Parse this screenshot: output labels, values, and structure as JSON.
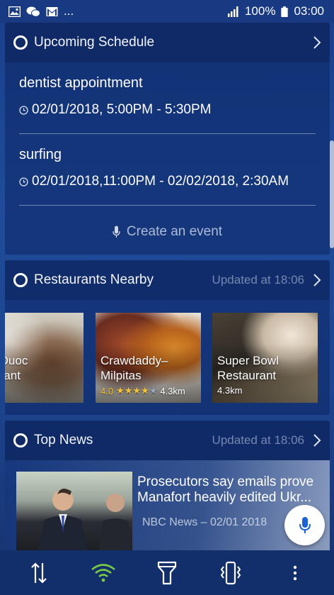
{
  "status_bar": {
    "left_icons": [
      "image-icon",
      "wechat-icon",
      "gmail-icon"
    ],
    "more": "...",
    "battery": "100%",
    "time": "03:00"
  },
  "schedule": {
    "title": "Upcoming Schedule",
    "events": [
      {
        "title": "dentist appointment",
        "time": "02/01/2018, 5:00PM - 5:30PM"
      },
      {
        "title": "surfing",
        "time": "02/01/2018,11:00PM - 02/02/2018, 2:30AM"
      }
    ],
    "create_label": "Create an event"
  },
  "restaurants": {
    "title": "Restaurants Nearby",
    "updated": "Updated at 18:06",
    "items": [
      {
        "name": "nh Duoc\ntaurant",
        "distance": "m",
        "rating": ""
      },
      {
        "name": "Crawdaddy–\nMilpitas",
        "rating": "4.0",
        "stars": 4,
        "distance": "4.3km"
      },
      {
        "name": "Super Bowl\nRestaurant",
        "distance": "4.3km",
        "rating": ""
      }
    ]
  },
  "news": {
    "title": "Top News",
    "updated": "Updated at 18:06",
    "headline": "Prosecutors say emails prove Manafort heavily edited Ukr...",
    "source": "NBC News – 02/01 2018"
  },
  "bottom_bar": [
    "rotate-icon",
    "wifi-icon",
    "flashlight-icon",
    "vibrate-icon",
    "more-vert-icon"
  ],
  "colors": {
    "background": "#1f4b99",
    "wifi_active": "#7ac943",
    "fab_mic": "#1a62d6"
  }
}
